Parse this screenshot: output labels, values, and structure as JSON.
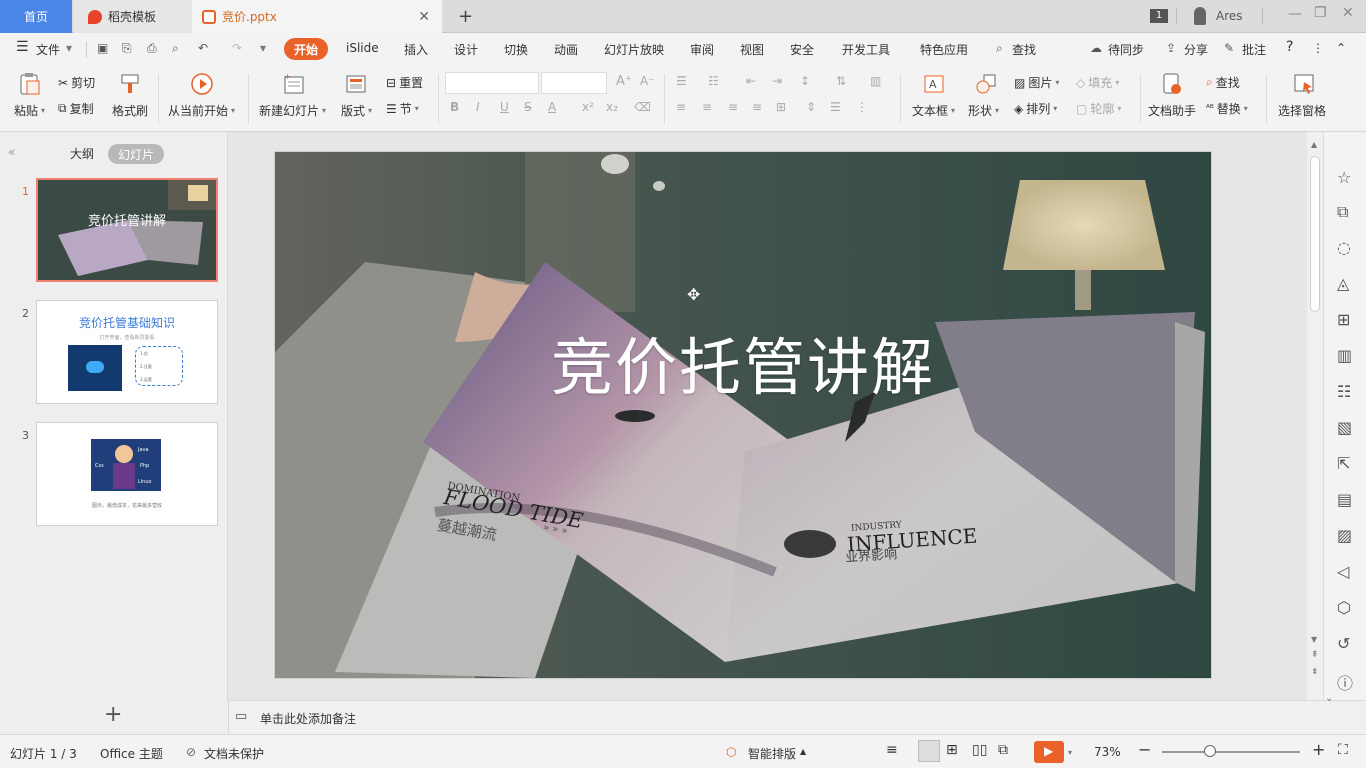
{
  "titlebar": {
    "home_tab": "首页",
    "template_tab": "稻壳模板",
    "doc_tab": "竞价.pptx",
    "user_name": "Ares",
    "badge": "1"
  },
  "menu": {
    "file": "文件",
    "items": [
      "开始",
      "iSlide",
      "插入",
      "设计",
      "切换",
      "动画",
      "幻灯片放映",
      "审阅",
      "视图",
      "安全",
      "开发工具",
      "特色应用"
    ],
    "search": "查找",
    "sync": "待同步",
    "share": "分享",
    "comment": "批注"
  },
  "ribbon": {
    "paste": "粘贴",
    "cut": "剪切",
    "copy": "复制",
    "format_painter": "格式刷",
    "from_current": "从当前开始",
    "new_slide": "新建幻灯片",
    "layout": "版式",
    "reset": "重置",
    "section": "节",
    "textbox": "文本框",
    "shape": "形状",
    "picture": "图片",
    "arrange": "排列",
    "fill": "填充",
    "outline": "轮廓",
    "doc_assistant": "文档助手",
    "find": "查找",
    "replace": "替换",
    "select_pane": "选择窗格"
  },
  "panel": {
    "outline_tab": "大纲",
    "slides_tab": "幻灯片",
    "thumbs": [
      {
        "num": "1",
        "title": "竞价托管讲解"
      },
      {
        "num": "2",
        "title": "竞价托管基础知识",
        "sub": "打开界面，查看新员能看",
        "items": [
          "1.优",
          "2.注意",
          "3.运营"
        ]
      },
      {
        "num": "3",
        "caption": "图示，最低成本，花来最多营收",
        "tag_words": [
          "Java",
          "Css",
          "Php",
          "Linux"
        ]
      }
    ]
  },
  "slide": {
    "title": "竞价托管讲解",
    "mag_left_small": "DOMINATION",
    "mag_left_big": "FLOOD TIDE",
    "mag_left_cn": "蔓越潮流",
    "mag_right_small": "INDUSTRY",
    "mag_right_big": "INFLUENCE",
    "mag_right_cn": "业界影响",
    "mag_arrows": "» » »"
  },
  "notes": {
    "placeholder": "单击此处添加备注"
  },
  "status": {
    "slide_count": "幻灯片 1 / 3",
    "theme": "Office 主题",
    "protect": "文档未保护",
    "smart_layout": "智能排版",
    "zoom": "73%"
  },
  "colors": {
    "accent": "#e8622a",
    "home_tab": "#4a86e8",
    "thumb_active": "#f08070"
  }
}
